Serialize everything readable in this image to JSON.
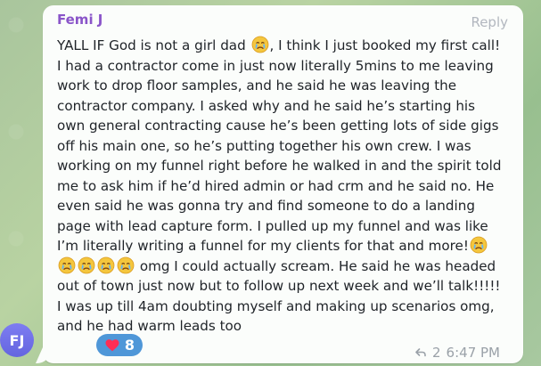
{
  "chat": {
    "sender_name": "Femi J",
    "reply_label": "Reply",
    "message_parts": {
      "p1": "YALL IF God is not a girl dad ",
      "p2": ", I think I just booked my first call! I had a contractor come in just now literally 5mins to me leaving work to drop floor samples, and he said he was leaving the contractor company. I asked why and he said he’s starting his own general contracting cause he’s been getting lots of side gigs off his main one, so he’s putting together his own crew. I was working on my funnel right before he walked in and the spirit told me to ask him if he’d hired admin or had crm and he said no. He even said he was gonna try and find someone to do a landing page with lead capture form. I pulled up my funnel and was like I’m literally writing a funnel for my clients for that and more!",
      "p3": " omg I could actually scream. He said he was headed out of town just now but to follow up next week and we’ll talk!!!!! I was up till 4am doubting myself and making up scenarios omg, and he had warm leads too"
    },
    "emoji_names": [
      "crying-face-emoji",
      "crying-face-emoji",
      "crying-face-emoji",
      "crying-face-emoji",
      "crying-face-emoji",
      "crying-face-emoji"
    ],
    "avatar_initials": "FJ",
    "reaction_count": "8",
    "forward_count": "2",
    "timestamp": "6:47 PM",
    "colors": {
      "sender": "#8a55c9",
      "reaction_bg": "#4f97d8",
      "avatar": "#6e6be8"
    }
  }
}
